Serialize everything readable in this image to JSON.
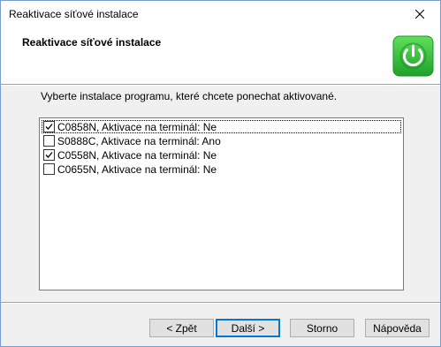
{
  "window": {
    "title": "Reaktivace síťové instalace"
  },
  "header": {
    "title": "Reaktivace síťové instalace",
    "icon": "power-icon",
    "icon_color": "#2ecc40"
  },
  "instruction": "Vyberte instalace programu, které chcete ponechat aktivované.",
  "items": [
    {
      "label": "C0858N, Aktivace na terminál: Ne",
      "checked": true,
      "focused": true
    },
    {
      "label": "S0888C, Aktivace na terminál: Ano",
      "checked": false,
      "focused": false
    },
    {
      "label": "C0558N, Aktivace na terminál: Ne",
      "checked": true,
      "focused": false
    },
    {
      "label": "C0655N, Aktivace na terminál: Ne",
      "checked": false,
      "focused": false
    }
  ],
  "buttons": {
    "back": "< Zpět",
    "next": "Další >",
    "cancel": "Storno",
    "help": "Nápověda"
  },
  "colors": {
    "accent": "#0078d7"
  }
}
